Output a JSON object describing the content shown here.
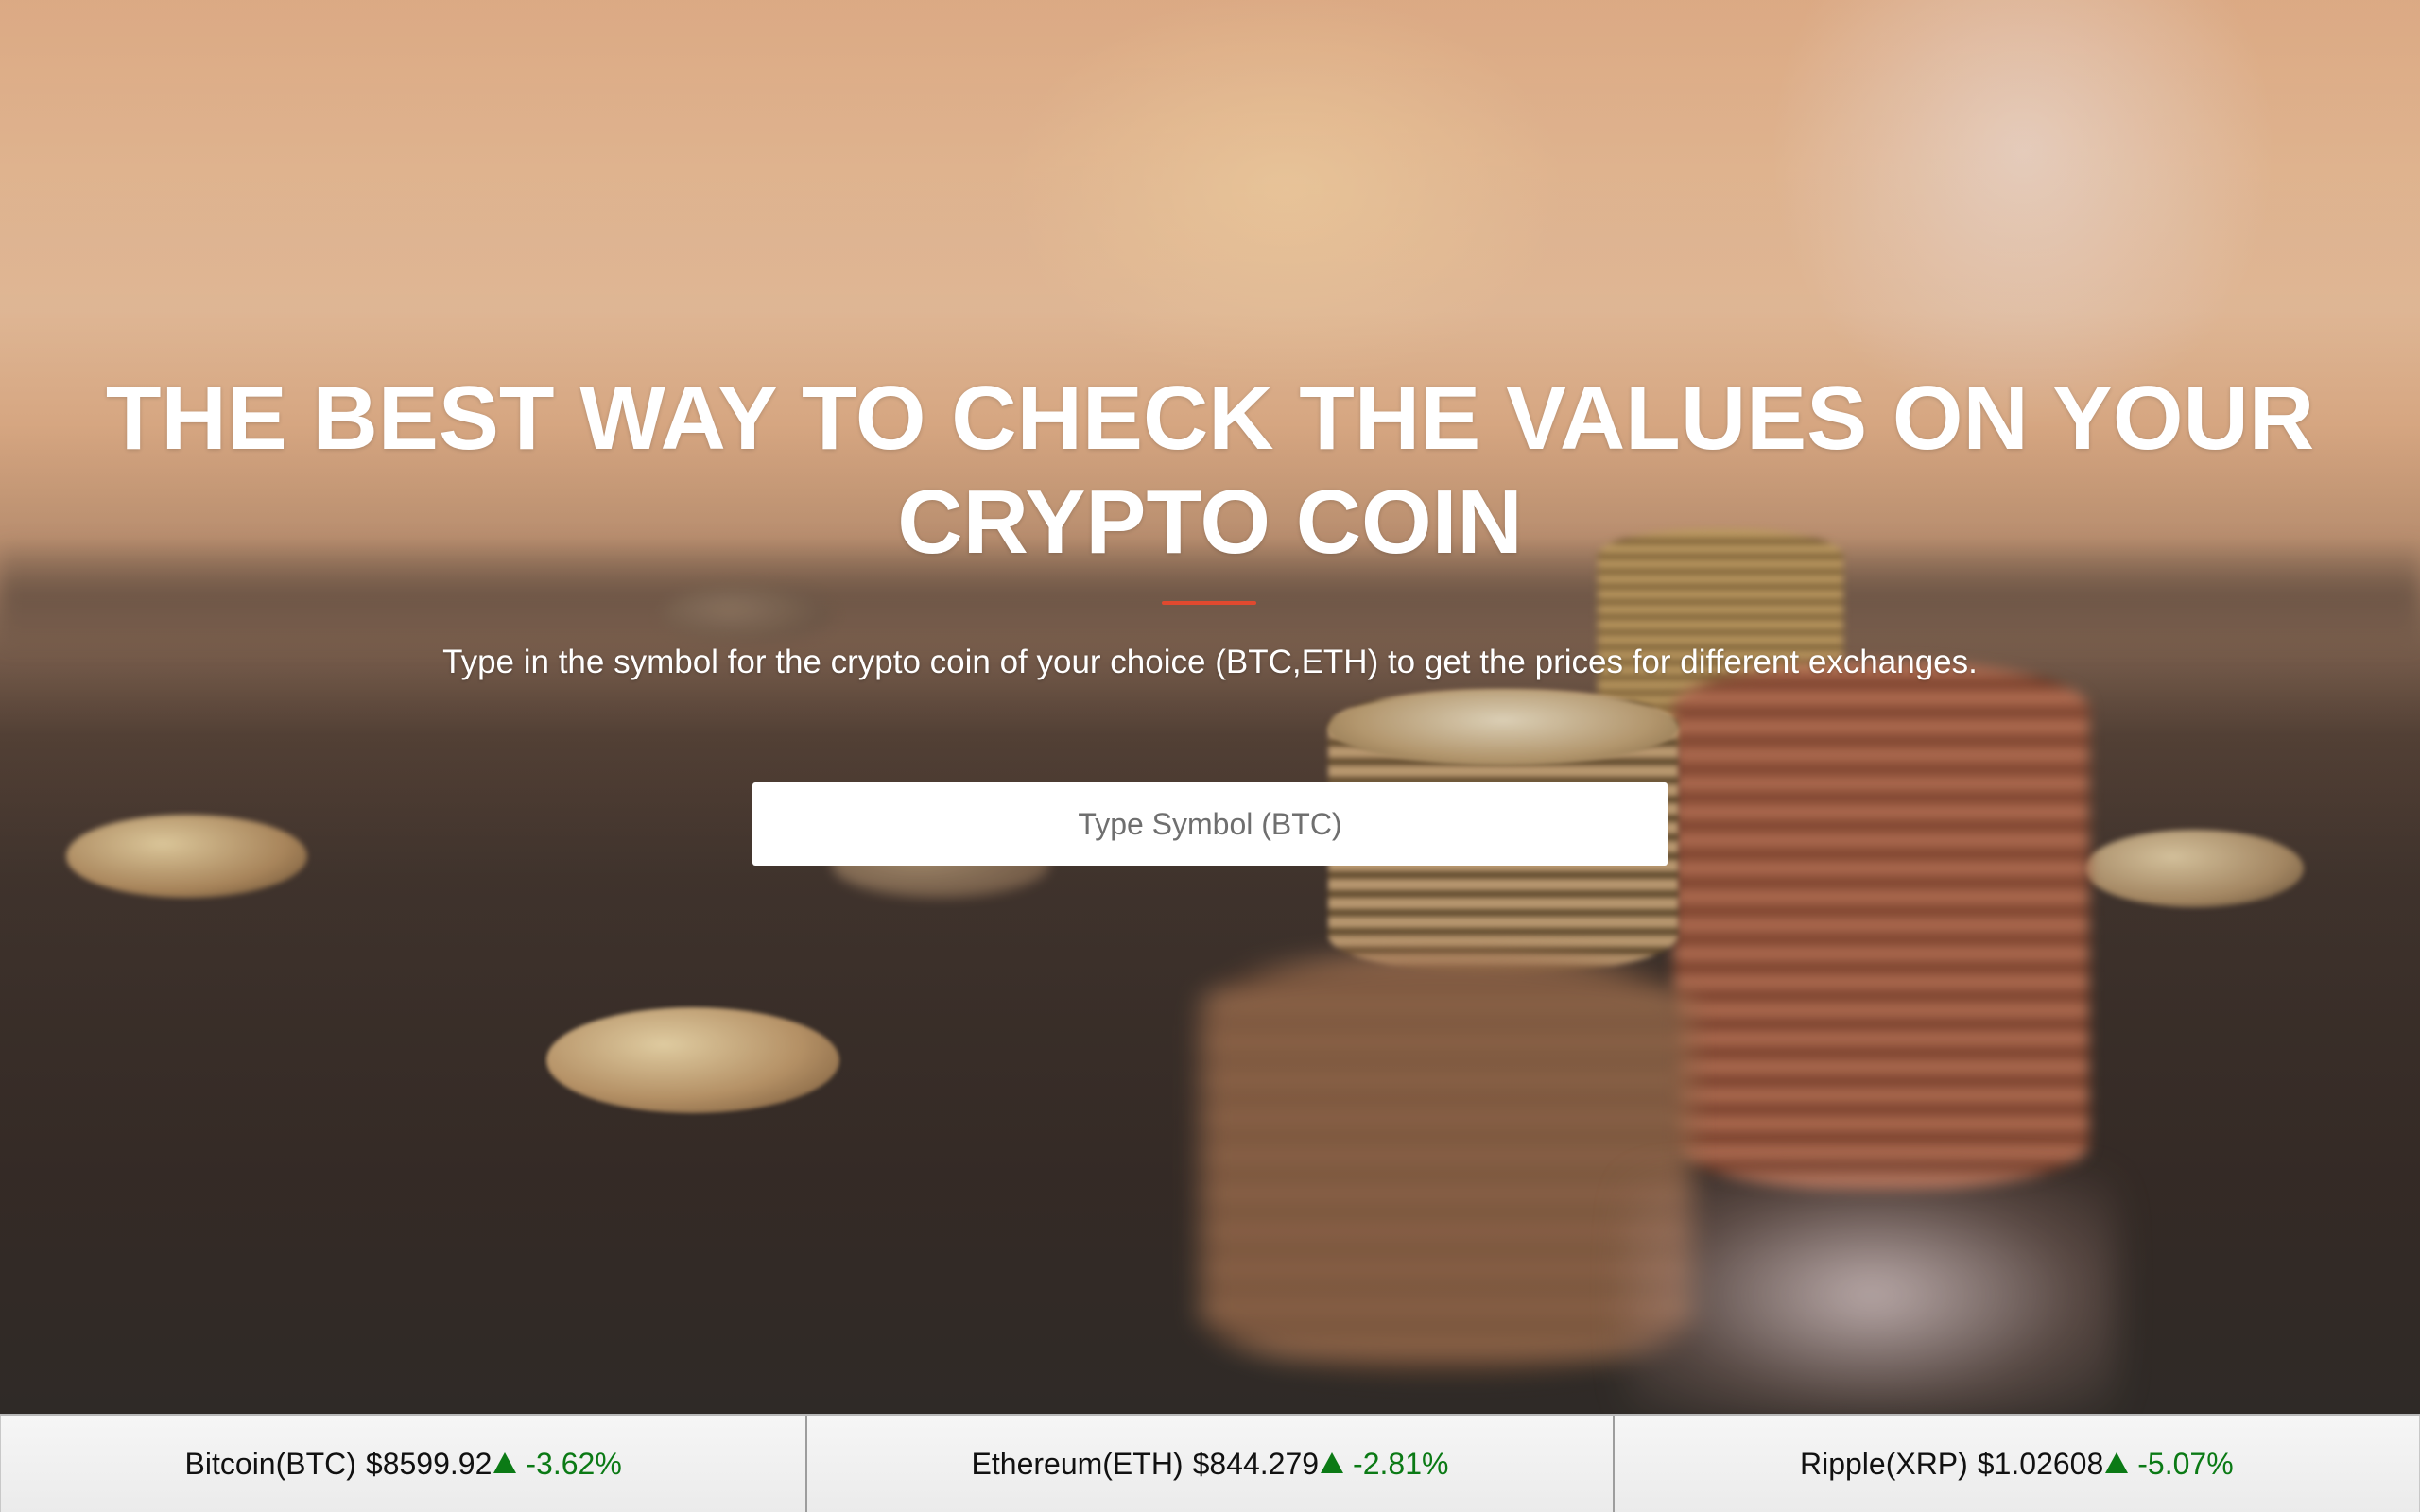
{
  "hero": {
    "headline": "THE BEST WAY TO CHECK THE VALUES ON YOUR CRYPTO COIN",
    "subtext": "Type in the symbol for the crypto coin of your choice (BTC,ETH) to get the prices for different exchanges.",
    "accent_color": "#e0492f"
  },
  "search": {
    "placeholder": "Type Symbol (BTC)",
    "value": ""
  },
  "ticker": {
    "arrow_icon": "triangle-up-icon",
    "change_color": "#0b7a15",
    "items": [
      {
        "name": "Bitcoin(BTC)",
        "price": "$8599.92",
        "change": "-3.62%"
      },
      {
        "name": "Ethereum(ETH)",
        "price": "$844.279",
        "change": "-2.81%"
      },
      {
        "name": "Ripple(XRP)",
        "price": "$1.02608",
        "change": "-5.07%"
      }
    ]
  }
}
